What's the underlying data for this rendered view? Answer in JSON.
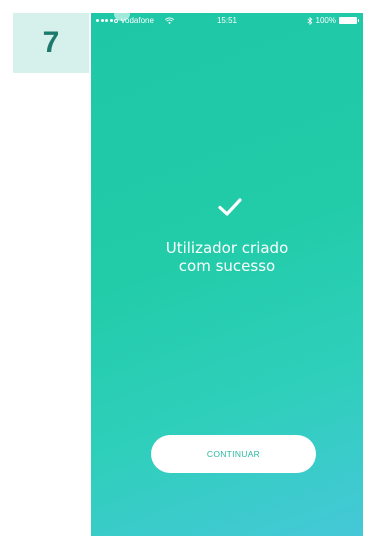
{
  "step_number": "7",
  "status_bar": {
    "carrier": "vodafone",
    "time": "15:51",
    "battery": "100%"
  },
  "main": {
    "message_line1": "Utilizador criado",
    "message_line2": "com sucesso",
    "continue_label": "CONTINUAR"
  },
  "colors": {
    "gradient_top": "#1ec7a6",
    "gradient_bottom": "#45c8d8",
    "badge_bg": "#d6f0ec",
    "badge_text": "#1f7a6e",
    "button_text": "#2ab9a0"
  },
  "icons": {
    "success": "check-icon",
    "wifi": "wifi-icon",
    "bluetooth": "bluetooth-icon",
    "battery": "battery-icon"
  }
}
